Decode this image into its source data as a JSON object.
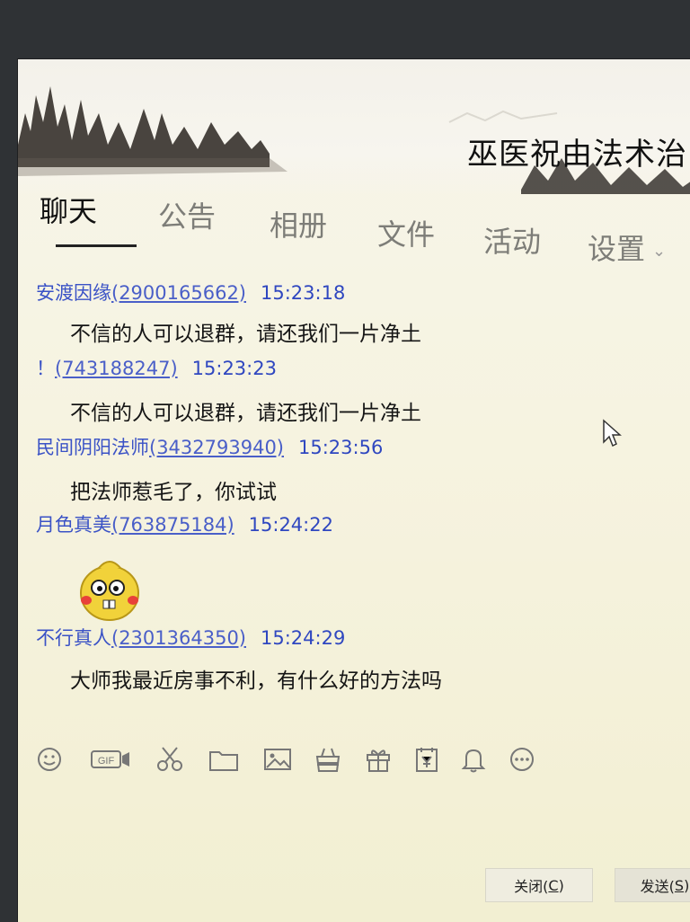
{
  "window": {
    "group_title": "巫医祝由法术治"
  },
  "tabs": [
    {
      "label": "聊天",
      "active": true
    },
    {
      "label": "公告",
      "active": false
    },
    {
      "label": "相册",
      "active": false
    },
    {
      "label": "文件",
      "active": false
    },
    {
      "label": "活动",
      "active": false
    },
    {
      "label": "设置",
      "active": false
    }
  ],
  "messages": [
    {
      "name": "安渡因缘",
      "qq": "(2900165662)",
      "time": "15:23:18",
      "text": "不信的人可以退群，请还我们一片净土"
    },
    {
      "name": "！",
      "qq": "(743188247)",
      "time": "15:23:23",
      "text": "不信的人可以退群，请还我们一片净土"
    },
    {
      "name": "民间阴阳法师",
      "qq": "(3432793940)",
      "time": "15:23:56",
      "text": "把法师惹毛了，你试试"
    },
    {
      "name": "月色真美",
      "qq": "(763875184)",
      "time": "15:24:22",
      "text": ""
    },
    {
      "name": "不行真人",
      "qq": "(2301364350)",
      "time": "15:24:29",
      "text": "大师我最近房事不利，有什么好的方法吗"
    }
  ],
  "toolbar": {
    "icons": [
      "smile-icon",
      "gif-icon",
      "scissors-icon",
      "folder-icon",
      "image-icon",
      "bag-icon",
      "gift-icon",
      "calendar-icon",
      "bell-icon",
      "more-icon"
    ],
    "gif_label": "GIF"
  },
  "buttons": {
    "close_label": "关闭(",
    "close_key": "C",
    "close_tail": ")",
    "send_label": "发送(",
    "send_key": "S",
    "send_tail": ")"
  },
  "colors": {
    "name_link": "#3a52c6",
    "background": "#f6f3e0"
  }
}
